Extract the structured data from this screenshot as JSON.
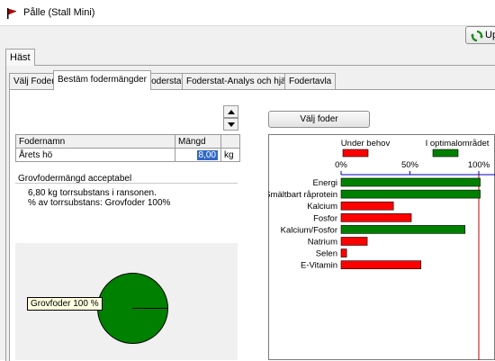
{
  "window": {
    "title": "Pålle  (Stall Mini)"
  },
  "toolbar": {
    "update_label": "Up"
  },
  "outer_tabs": [
    {
      "label": "Häst"
    }
  ],
  "sub_tabs": [
    {
      "label": "Välj Foder"
    },
    {
      "label": "Bestäm fodermängder"
    },
    {
      "label": "Foderstat"
    },
    {
      "label": "Foderstat-Analys och hjälp"
    },
    {
      "label": "Fodertavla"
    }
  ],
  "feed_table": {
    "headers": [
      "Fodernamn",
      "Mängd"
    ],
    "rows": [
      {
        "name": "Årets hö",
        "amount": "8,00",
        "unit": "kg"
      }
    ]
  },
  "summary": {
    "title": "Grovfodermängd acceptabel",
    "line1": "6,80 kg torrsubstans i ransonen.",
    "line2": "% av torrsubstans: Grovfoder 100%"
  },
  "pie": {
    "label": "Grovfoder 100 %",
    "value": 100,
    "color": "#008000"
  },
  "select_feed_button": "Välj foder",
  "colors": {
    "under": "#ff0000",
    "optimal": "#008000",
    "axis": "#0000c0",
    "ref_line": "#c00000"
  },
  "chart_data": {
    "type": "bar",
    "orientation": "horizontal",
    "legend": [
      {
        "name": "Under behov",
        "color": "#ff0000"
      },
      {
        "name": "I optimalområdet",
        "color": "#008000"
      }
    ],
    "x_ticks": [
      "0%",
      "50%",
      "100%"
    ],
    "xlim": [
      0,
      100
    ],
    "categories": [
      "Energi",
      "Smältbart råprotein",
      "Kalcium",
      "Fosfor",
      "Kalcium/Fosfor",
      "Natrium",
      "Selen",
      "E-Vitamin"
    ],
    "values": [
      101,
      101,
      38,
      51,
      90,
      19,
      4,
      58
    ],
    "status": [
      "optimal",
      "optimal",
      "under",
      "under",
      "optimal",
      "under",
      "under",
      "under"
    ],
    "reference_line": 100
  }
}
